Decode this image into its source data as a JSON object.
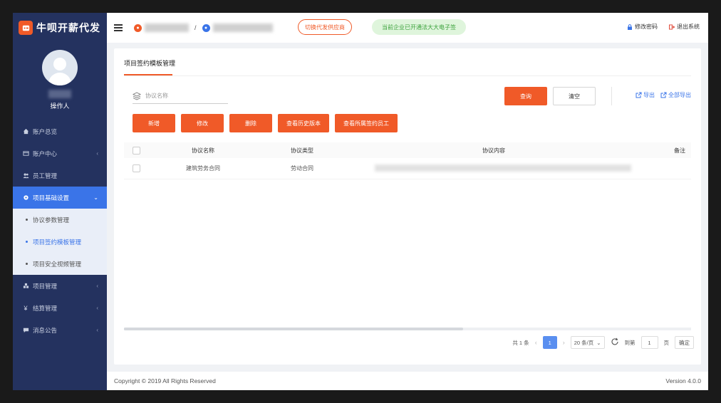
{
  "brand": {
    "name": "牛呗开薪代发"
  },
  "profile": {
    "role": "操作人"
  },
  "sidebar": {
    "items": [
      {
        "label": "账户总览"
      },
      {
        "label": "账户中心"
      },
      {
        "label": "员工管理"
      },
      {
        "label": "项目基础设置"
      },
      {
        "label": "项目管理"
      },
      {
        "label": "结算管理"
      },
      {
        "label": "消息公告"
      }
    ],
    "submenu": [
      {
        "label": "协议参数管理"
      },
      {
        "label": "项目签约模板管理"
      },
      {
        "label": "项目安全视频管理"
      }
    ]
  },
  "topbar": {
    "crumb_sep": "/",
    "switch_label": "切换代发供应商",
    "notice": "当前企业已开通法大大电子签",
    "change_password": "修改密码",
    "logout": "退出系统"
  },
  "page": {
    "tab": "项目签约模板管理"
  },
  "search": {
    "placeholder": "协议名称"
  },
  "toolbar": {
    "query": "查询",
    "reset": "清空",
    "export": "导出",
    "export_all": "全部导出"
  },
  "actions": {
    "add": "新增",
    "edit": "修改",
    "delete": "删除",
    "history": "查看历史版本",
    "signed_staff": "查看所属签约员工"
  },
  "table": {
    "headers": [
      "协议名称",
      "协议类型",
      "协议内容",
      "备注"
    ],
    "rows": [
      {
        "name": "建筑劳务合同",
        "type": "劳动合同"
      }
    ]
  },
  "pager": {
    "total": "共 1 条",
    "current_page": "1",
    "page_size": "20 条/页",
    "goto_label": "到第",
    "goto_value": "1",
    "page_unit": "页",
    "confirm": "确定"
  },
  "footer": {
    "copyright": "Copyright © 2019 All Rights Reserved",
    "version": "Version 4.0.0"
  },
  "colors": {
    "sidebar_bg": "#24325f",
    "accent_orange": "#f05a28",
    "active_blue": "#3a74e8"
  }
}
